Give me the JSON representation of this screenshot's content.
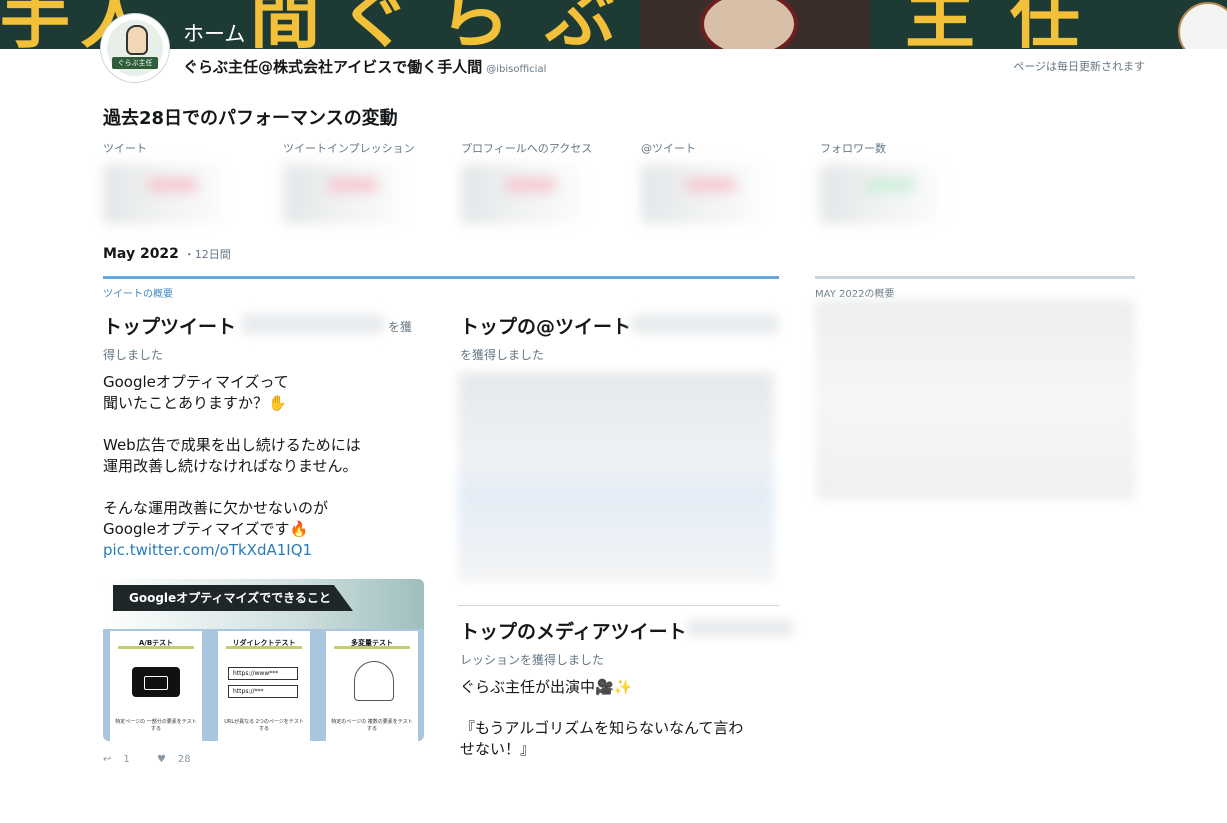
{
  "banner": {
    "title": "ホーム",
    "chars": [
      "手",
      "人",
      "間",
      "ぐ",
      "ら",
      "ぶ",
      "主",
      "任"
    ]
  },
  "avatar": {
    "label": "ぐらぶ主任"
  },
  "user": {
    "name": "ぐらぶ主任@株式会社アイビスで働く手人間",
    "handle": "@ibisofficial"
  },
  "update_note": "ページは毎日更新されます",
  "performance": {
    "title": "過去28日でのパフォーマンスの変動",
    "metrics": [
      {
        "label": "ツイート"
      },
      {
        "label": "ツイートインプレッション"
      },
      {
        "label": "プロフィールへのアクセス"
      },
      {
        "label": "@ツイート"
      },
      {
        "label": "フォロワー数"
      }
    ]
  },
  "period": {
    "title": "May 2022",
    "sub": "・12日間"
  },
  "tweets_overview": {
    "section_label": "ツイートの概要",
    "top_tweet": {
      "title": "トップツイート",
      "title_suffix": "を獲",
      "sub": "得しました",
      "lines": [
        "Googleオプティマイズって",
        "聞いたことありますか？✋",
        "",
        "Web広告で成果を出し続けるためには",
        "運用改善し続けなければなりません。",
        "",
        "そんな運用改善に欠かせないのが",
        "Googleオプティマイズです🔥"
      ],
      "link": "pic.twitter.com/oTkXdA1IQ1",
      "card": {
        "heading": "Googleオプティマイズでできること",
        "panels": [
          {
            "title": "A/Bテスト",
            "foot": "特定ページの\n一部分の要素をテストする"
          },
          {
            "title": "リダイレクトテスト",
            "foot": "URLが異なる\n2つのページをテストする",
            "urls": [
              "https://www***",
              "https://***"
            ]
          },
          {
            "title": "多変量テスト",
            "foot": "特定のページの\n複数の要素をテストする"
          }
        ]
      },
      "retweets": "1",
      "likes": "28"
    },
    "top_mention": {
      "title": "トップの@ツイート",
      "sub": "を獲得しました"
    },
    "top_media": {
      "title": "トップのメディアツイート",
      "sub": "レッションを獲得しました",
      "lines": [
        "ぐらぶ主任が出演中🎥✨",
        "",
        "『もうアルゴリズムを知らないなんて言わ",
        "せない！』"
      ]
    }
  },
  "summary": {
    "section_label": "MAY 2022の概要"
  }
}
